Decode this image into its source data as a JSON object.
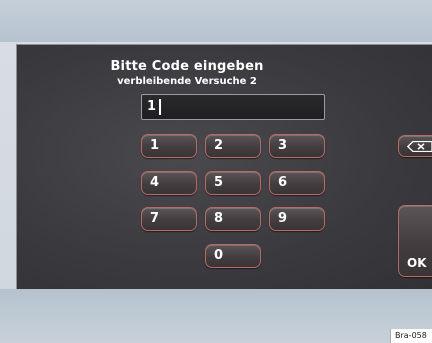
{
  "dialog": {
    "title": "Bitte Code eingeben",
    "subtitle": "verbleibende Versuche 2",
    "code_value": "1"
  },
  "keypad": {
    "keys": [
      "1",
      "2",
      "3",
      "4",
      "5",
      "6",
      "7",
      "8",
      "9",
      "0"
    ]
  },
  "side_buttons": {
    "backspace_icon": "backspace-icon",
    "ok_label": "OK"
  },
  "figure_ref": "Bra-058"
}
